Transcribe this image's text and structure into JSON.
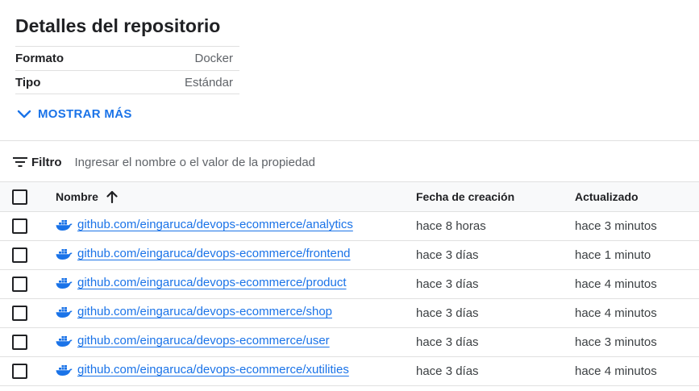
{
  "details": {
    "title": "Detalles del repositorio",
    "properties": [
      {
        "key": "Formato",
        "value": "Docker"
      },
      {
        "key": "Tipo",
        "value": "Estándar"
      }
    ],
    "show_more": "MOSTRAR MÁS"
  },
  "filter": {
    "label": "Filtro",
    "placeholder": "Ingresar el nombre o el valor de la propiedad"
  },
  "table": {
    "headers": {
      "name": "Nombre",
      "created": "Fecha de creación",
      "updated": "Actualizado"
    },
    "rows": [
      {
        "name": "github.com/eingaruca/devops-ecommerce/analytics",
        "created": "hace 8 horas",
        "updated": "hace 3 minutos"
      },
      {
        "name": "github.com/eingaruca/devops-ecommerce/frontend",
        "created": "hace 3 días",
        "updated": "hace 1 minuto"
      },
      {
        "name": "github.com/eingaruca/devops-ecommerce/product",
        "created": "hace 3 días",
        "updated": "hace 4 minutos"
      },
      {
        "name": "github.com/eingaruca/devops-ecommerce/shop",
        "created": "hace 3 días",
        "updated": "hace 4 minutos"
      },
      {
        "name": "github.com/eingaruca/devops-ecommerce/user",
        "created": "hace 3 días",
        "updated": "hace 3 minutos"
      },
      {
        "name": "github.com/eingaruca/devops-ecommerce/xutilities",
        "created": "hace 3 días",
        "updated": "hace 4 minutos"
      }
    ]
  },
  "icons": {
    "row": "docker-icon",
    "sort": "arrow-up-icon",
    "filter": "filter-icon",
    "expand": "chevron-down-icon"
  },
  "colors": {
    "link": "#1a73e8",
    "header_bg": "#f8f9fa",
    "border": "#e0e0e0"
  }
}
